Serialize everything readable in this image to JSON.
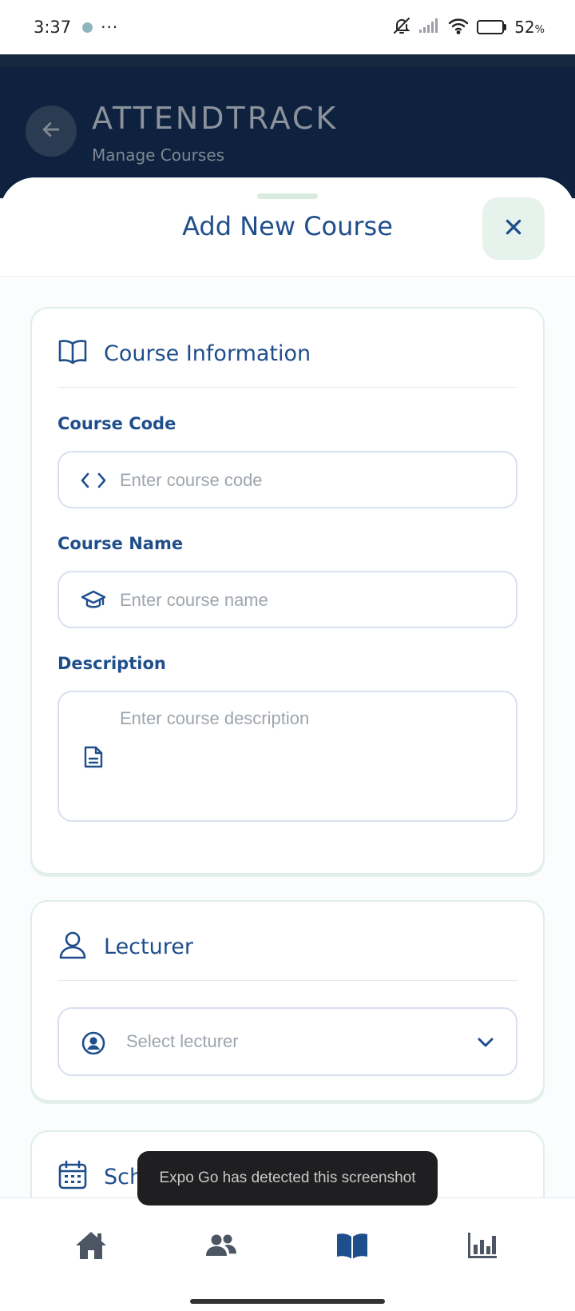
{
  "status_bar": {
    "time": "3:37",
    "more": "···",
    "battery_level": 52,
    "battery_text": "52",
    "battery_unit": "%"
  },
  "header": {
    "title": "ATTENDTRACK",
    "subtitle": "Manage Courses"
  },
  "sheet": {
    "title": "Add New Course"
  },
  "course_info": {
    "title": "Course Information",
    "code_label": "Course Code",
    "code_placeholder": "Enter course code",
    "name_label": "Course Name",
    "name_placeholder": "Enter course name",
    "desc_label": "Description",
    "desc_placeholder": "Enter course description"
  },
  "lecturer": {
    "title": "Lecturer",
    "select_placeholder": "Select lecturer"
  },
  "schedule": {
    "title_visible": "Sch"
  },
  "toast": {
    "text": "Expo Go has detected this screenshot"
  },
  "bottom_nav": {
    "active": "courses",
    "items": [
      "home",
      "students",
      "courses",
      "reports"
    ]
  },
  "colors": {
    "primary": "#1f4e8c",
    "header_bg": "#0e2240",
    "accent_soft": "#e6f2ec",
    "inactive_icon": "#4b5563"
  }
}
